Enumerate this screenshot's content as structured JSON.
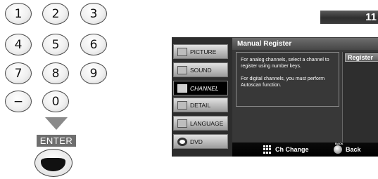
{
  "remote": {
    "keys": [
      {
        "label": "1"
      },
      {
        "label": "2"
      },
      {
        "label": "3"
      },
      {
        "label": "4"
      },
      {
        "label": "5"
      },
      {
        "label": "6"
      },
      {
        "label": "7"
      },
      {
        "label": "8"
      },
      {
        "label": "9"
      },
      {
        "label": "−"
      },
      {
        "label": "0"
      }
    ],
    "enter_label": "ENTER"
  },
  "channel_display": "11",
  "menu": {
    "items": [
      {
        "label": "PICTURE",
        "icon": "picture-icon",
        "selected": false
      },
      {
        "label": "SOUND",
        "icon": "sound-icon",
        "selected": false
      },
      {
        "label": "CHANNEL",
        "icon": "channel-icon",
        "selected": true
      },
      {
        "label": "DETAIL",
        "icon": "detail-icon",
        "selected": false
      },
      {
        "label": "LANGUAGE",
        "icon": "language-icon",
        "selected": false
      },
      {
        "label": "DVD",
        "icon": "dvd-icon",
        "selected": false
      }
    ],
    "title": "Manual Register",
    "info_lines": [
      "For analog channels, select a channel to register using number keys.",
      "For digital channels, you must perform Autoscan function."
    ],
    "register_label": "Register",
    "footer": {
      "ch_change": "Ch Change",
      "back_tag": "BACK",
      "back": "Back"
    }
  }
}
